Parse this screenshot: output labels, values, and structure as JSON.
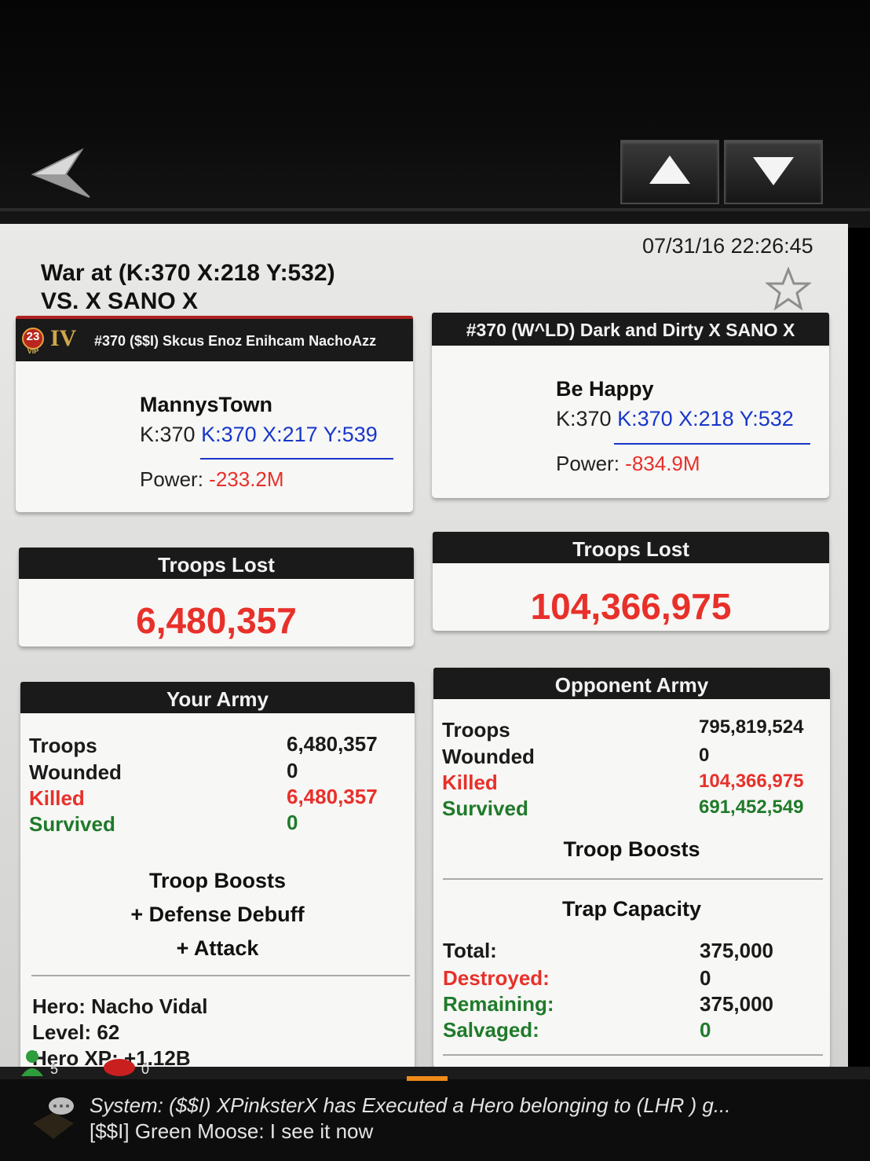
{
  "header": {
    "timestamp": "07/31/16 22:26:45",
    "title_line1": "War at (K:370 X:218 Y:532)",
    "title_line2": "VS. X SANO X"
  },
  "player": {
    "vip_level": "23",
    "vip_label": "VIP",
    "rank": "IV",
    "name": "#370 ($$I) Skcus Enoz Enihcam NachoAzz",
    "city": "MannysTown",
    "kingdom_prefix": "K:370",
    "coords": "K:370 X:217 Y:539",
    "power_label": "Power:",
    "power_value": "-233.2M",
    "troops_lost_label": "Troops Lost",
    "troops_lost": "6,480,357"
  },
  "opponent": {
    "name": "#370 (W^LD) Dark and Dirty X SANO X",
    "city": "Be Happy",
    "kingdom_prefix": "K:370",
    "coords": "K:370 X:218 Y:532",
    "power_label": "Power:",
    "power_value": "-834.9M",
    "troops_lost_label": "Troops Lost",
    "troops_lost": "104,366,975"
  },
  "your_army": {
    "title": "Your Army",
    "rows": [
      {
        "label": "Troops",
        "value": "6,480,357"
      },
      {
        "label": "Wounded",
        "value": "0"
      },
      {
        "label": "Killed",
        "value": "6,480,357"
      },
      {
        "label": "Survived",
        "value": "0"
      }
    ],
    "boosts_title": "Troop Boosts",
    "boosts": [
      "+ Defense Debuff",
      "+ Attack"
    ],
    "hero_name": "Hero: Nacho Vidal",
    "hero_level": "Level: 62",
    "hero_xp": "Hero XP: +1.12B"
  },
  "opponent_army": {
    "title": "Opponent Army",
    "rows": [
      {
        "label": "Troops",
        "value": "795,819,524"
      },
      {
        "label": "Wounded",
        "value": "0"
      },
      {
        "label": "Killed",
        "value": "104,366,975"
      },
      {
        "label": "Survived",
        "value": "691,452,549"
      }
    ],
    "boosts_title": "Troop Boosts",
    "trap_title": "Trap Capacity",
    "traps": [
      {
        "label": "Total:",
        "value": "375,000"
      },
      {
        "label": "Destroyed:",
        "value": "0"
      },
      {
        "label": "Remaining:",
        "value": "375,000"
      },
      {
        "label": "Salvaged:",
        "value": "0"
      }
    ]
  },
  "status": {
    "green_count": "5",
    "red_count": "0"
  },
  "chat": {
    "line1": "System: ($$I) XPinksterX has Executed a Hero belonging to (LHR ) g...",
    "line2": "[$$I] Green Moose: I see it now"
  },
  "colors": {
    "header_bg": "#1a1a1a",
    "red_value": "#e8302a",
    "green_value": "#1f7a2a",
    "link_blue": "#1837c9"
  },
  "icons": [
    "back-arrow-icon",
    "up-arrow-icon",
    "down-arrow-icon",
    "star-icon",
    "vip-badge-icon",
    "chat-bubble-icon"
  ]
}
